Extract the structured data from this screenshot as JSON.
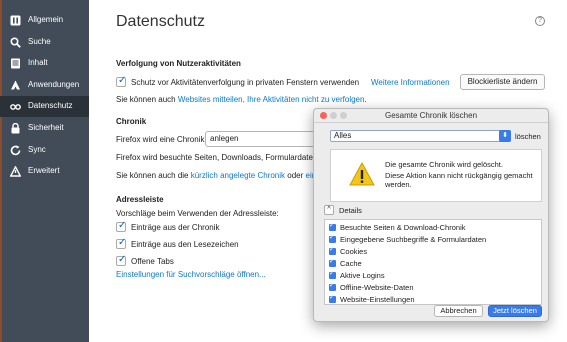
{
  "sidebar": {
    "items": [
      {
        "label": "Allgemein",
        "icon": "general-icon",
        "active": false
      },
      {
        "label": "Suche",
        "icon": "search-icon",
        "active": false
      },
      {
        "label": "Inhalt",
        "icon": "content-icon",
        "active": false
      },
      {
        "label": "Anwendungen",
        "icon": "applications-icon",
        "active": false
      },
      {
        "label": "Datenschutz",
        "icon": "privacy-icon",
        "active": true
      },
      {
        "label": "Sicherheit",
        "icon": "lock-icon",
        "active": false
      },
      {
        "label": "Sync",
        "icon": "sync-icon",
        "active": false
      },
      {
        "label": "Erweitert",
        "icon": "advanced-icon",
        "active": false
      }
    ]
  },
  "main": {
    "title": "Datenschutz",
    "help": "?",
    "tracking": {
      "heading": "Verfolgung von Nutzeraktivitäten",
      "checkbox_label": "Schutz vor Aktivitätenverfolgung in privaten Fenstern verwenden",
      "more_info": "Weitere Informationen",
      "blocklist_button": "Blockierliste ändern",
      "note_prefix": "Sie können auch",
      "note_link": "Websites mitteilen, Ihre Aktivitäten nicht zu verfolgen",
      "note_suffix": "."
    },
    "history": {
      "heading": "Chronik",
      "mode_prefix": "Firefox wird eine Chronik:",
      "mode_value": "anlegen",
      "desc": "Firefox wird besuchte Seiten, Downloads, Formulardaten,",
      "note_prefix": "Sie können auch die",
      "note_link": "kürzlich angelegte Chronik",
      "note_mid": "oder",
      "note_link2": "einz"
    },
    "addressbar": {
      "heading": "Adressleiste",
      "desc": "Vorschläge beim Verwenden der Adressleiste:",
      "options": [
        {
          "label": "Einträge aus der Chronik",
          "checked": true
        },
        {
          "label": "Einträge aus den Lesezeichen",
          "checked": true
        },
        {
          "label": "Offene Tabs",
          "checked": true
        }
      ],
      "settings_link": "Einstellungen für Suchvorschläge öffnen..."
    }
  },
  "dialog": {
    "title": "Gesamte Chronik löschen",
    "range_value": "Alles",
    "range_suffix": "löschen",
    "warning_line1": "Die gesamte Chronik wird gelöscht.",
    "warning_line2": "Diese Aktion kann nicht rückgängig gemacht werden.",
    "details_label": "Details",
    "items": [
      {
        "label": "Besuchte Seiten & Download-Chronik",
        "checked": true
      },
      {
        "label": "Eingegebene Suchbegriffe & Formulardaten",
        "checked": true
      },
      {
        "label": "Cookies",
        "checked": true
      },
      {
        "label": "Cache",
        "checked": true
      },
      {
        "label": "Aktive Logins",
        "checked": true
      },
      {
        "label": "Offline-Website-Daten",
        "checked": true
      },
      {
        "label": "Website-Einstellungen",
        "checked": true
      }
    ],
    "cancel_label": "Abbrechen",
    "confirm_label": "Jetzt löschen",
    "colors": {
      "accent": "#3a7bea",
      "close": "#fc605b",
      "minimize": "#fdbc40",
      "zoom": "#34c84a"
    }
  }
}
